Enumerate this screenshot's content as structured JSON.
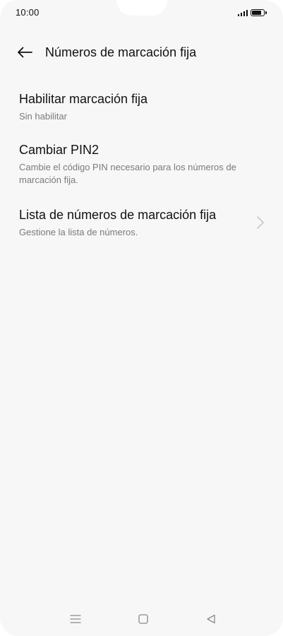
{
  "status_bar": {
    "time": "10:00",
    "signal_icon": "signal-icon",
    "battery_icon": "battery-icon",
    "battery_level": 0.85
  },
  "header": {
    "back_icon": "arrow-left-icon",
    "title": "Números de marcación fija"
  },
  "settings": [
    {
      "title": "Habilitar marcación fija",
      "subtitle": "Sin habilitar"
    },
    {
      "title": "Cambiar PIN2",
      "subtitle": "Cambie el código PIN necesario para los números de marcación fija."
    },
    {
      "title": "Lista de números de marcación fija",
      "subtitle": "Gestione la lista de números.",
      "icon": "chevron-right-icon"
    }
  ],
  "nav_bar": {
    "menu_icon": "menu-icon",
    "home_icon": "home-square-icon",
    "back_icon": "back-triangle-icon"
  },
  "colors": {
    "background": "#f7f7f7",
    "text_primary": "#111111",
    "text_secondary": "#7a7a7a",
    "chevron": "#c8c8c8",
    "nav_icon": "#8a8a8a"
  }
}
